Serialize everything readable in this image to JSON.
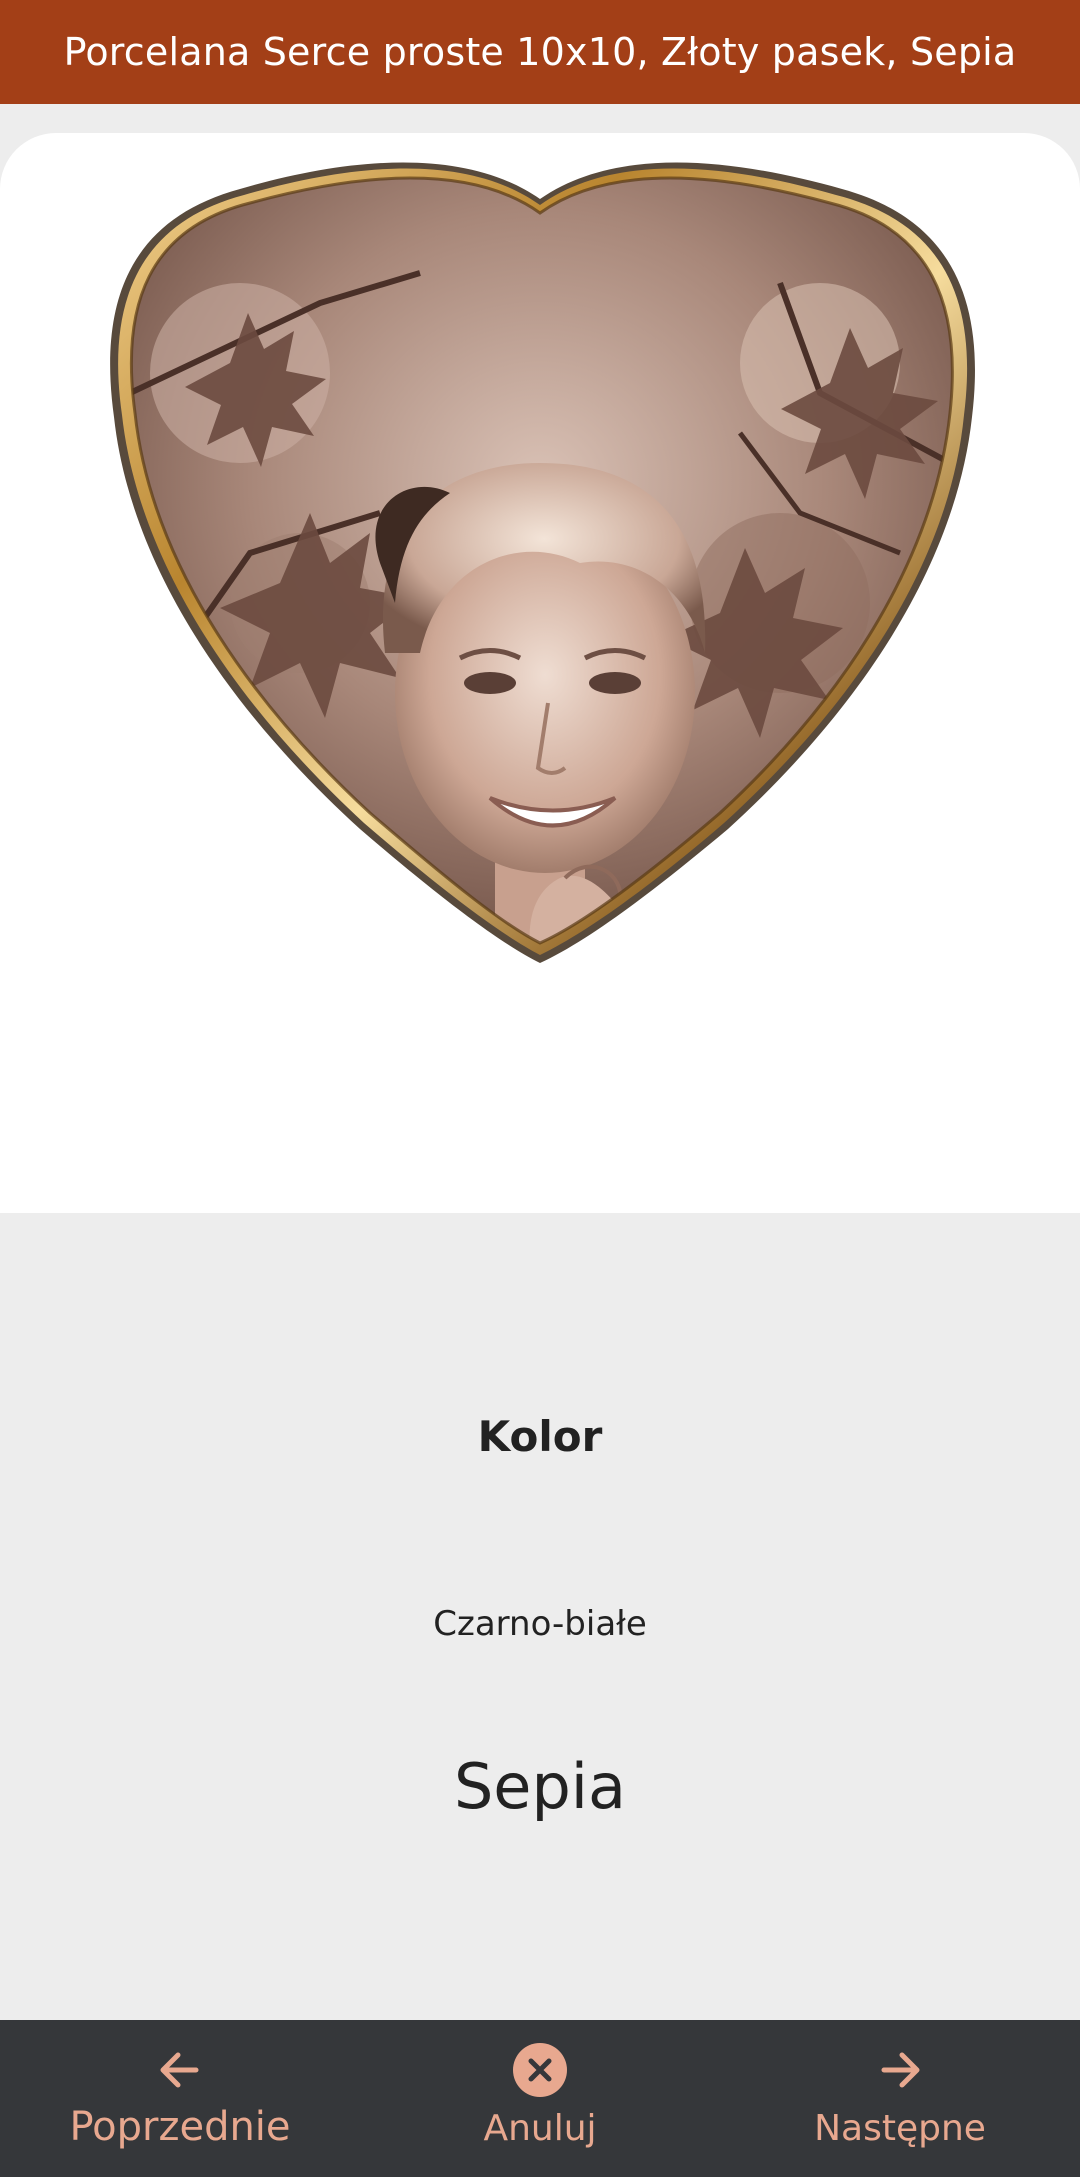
{
  "header": {
    "title": "Porcelana Serce proste 10x10, Złoty pasek, Sepia"
  },
  "preview": {
    "frame_color": "#c9974a",
    "tone": "sepia",
    "icon": "heart-porcelain-photo"
  },
  "options": {
    "section_label": "Kolor",
    "items": [
      {
        "label": "Czarno-białe",
        "selected": false
      },
      {
        "label": "Sepia",
        "selected": true
      }
    ]
  },
  "bottom_nav": {
    "prev_label": "Poprzednie",
    "cancel_label": "Anuluj",
    "next_label": "Następne",
    "accent_color": "#e8a88f",
    "bar_color": "#35373a"
  },
  "colors": {
    "header_bg": "#a33f17",
    "page_bg": "#ededed"
  }
}
